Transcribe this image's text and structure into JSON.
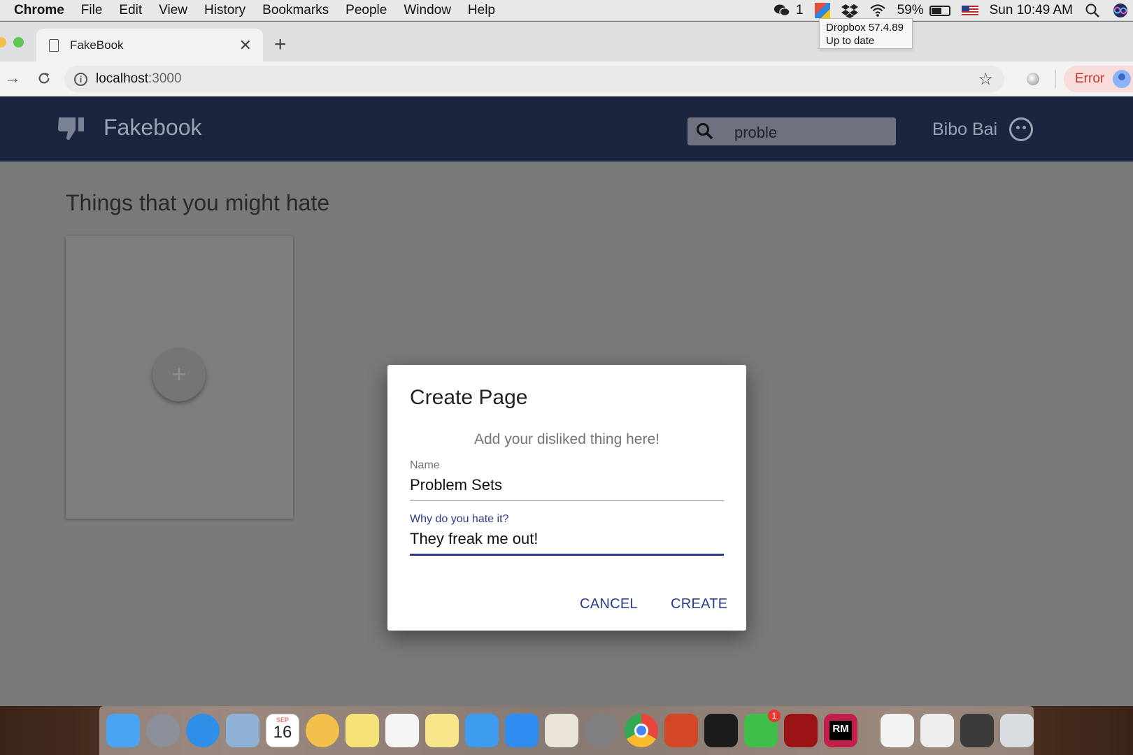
{
  "menubar": {
    "app": "Chrome",
    "items": [
      "File",
      "Edit",
      "View",
      "History",
      "Bookmarks",
      "People",
      "Window",
      "Help"
    ],
    "wechat_count": "1",
    "battery": "59%",
    "battery_level": 0.59,
    "clock": "Sun 10:49 AM"
  },
  "tooltip": {
    "line1": "Dropbox 57.4.89",
    "line2": "Up to date"
  },
  "browser": {
    "tab_title": "FakeBook",
    "url_host": "localhost",
    "url_port": ":3000",
    "error_label": "Error"
  },
  "app": {
    "title": "Fakebook",
    "search_value": "proble",
    "username": "Bibo Bai",
    "heading": "Things that you might hate",
    "add_symbol": "+"
  },
  "dialog": {
    "title": "Create Page",
    "subtitle": "Add your disliked thing here!",
    "name_label": "Name",
    "name_value": "Problem Sets",
    "reason_label": "Why do you hate it?",
    "reason_value": "They freak me out!",
    "cancel": "CANCEL",
    "create": "CREATE"
  },
  "dock": {
    "calendar_month": "SEP",
    "calendar_day": "16",
    "wechat_badge": "1",
    "rubymine_label": "RM",
    "apps": [
      {
        "name": "finder-icon",
        "color": "#4aa3f0"
      },
      {
        "name": "launchpad-icon",
        "color": "#8a8f99"
      },
      {
        "name": "safari-icon",
        "color": "#2e8ee8"
      },
      {
        "name": "preview-icon",
        "color": "#8fb1d6"
      },
      {
        "name": "calendar-icon",
        "color": "#ffffff"
      },
      {
        "name": "photos-icon",
        "color": "#f3c04a"
      },
      {
        "name": "stickies-icon",
        "color": "#f7e27a"
      },
      {
        "name": "reminders-icon",
        "color": "#f4f4f4"
      },
      {
        "name": "notes-icon",
        "color": "#f7e58a"
      },
      {
        "name": "messages-icon",
        "color": "#3d9cf0"
      },
      {
        "name": "app-store-icon",
        "color": "#2f8cf0"
      },
      {
        "name": "textedit-icon",
        "color": "#e9e4d6"
      },
      {
        "name": "system-preferences-icon",
        "color": "#7f7f82"
      },
      {
        "name": "chrome-icon",
        "color": "#e8453c"
      },
      {
        "name": "powerpoint-icon",
        "color": "#d24726"
      },
      {
        "name": "terminal-icon",
        "color": "#1c1c1c"
      },
      {
        "name": "wechat-icon",
        "color": "#3fbf4a"
      },
      {
        "name": "acrobat-icon",
        "color": "#9b1313"
      },
      {
        "name": "rubymine-icon",
        "color": "#c21f4b"
      }
    ],
    "docs": [
      {
        "name": "document-icon",
        "color": "#f2f2f2"
      },
      {
        "name": "pdf-stack-icon",
        "color": "#eeeeee"
      },
      {
        "name": "screen-stack-icon",
        "color": "#3b3b3b"
      },
      {
        "name": "trash-icon",
        "color": "#d9dde0"
      }
    ]
  }
}
